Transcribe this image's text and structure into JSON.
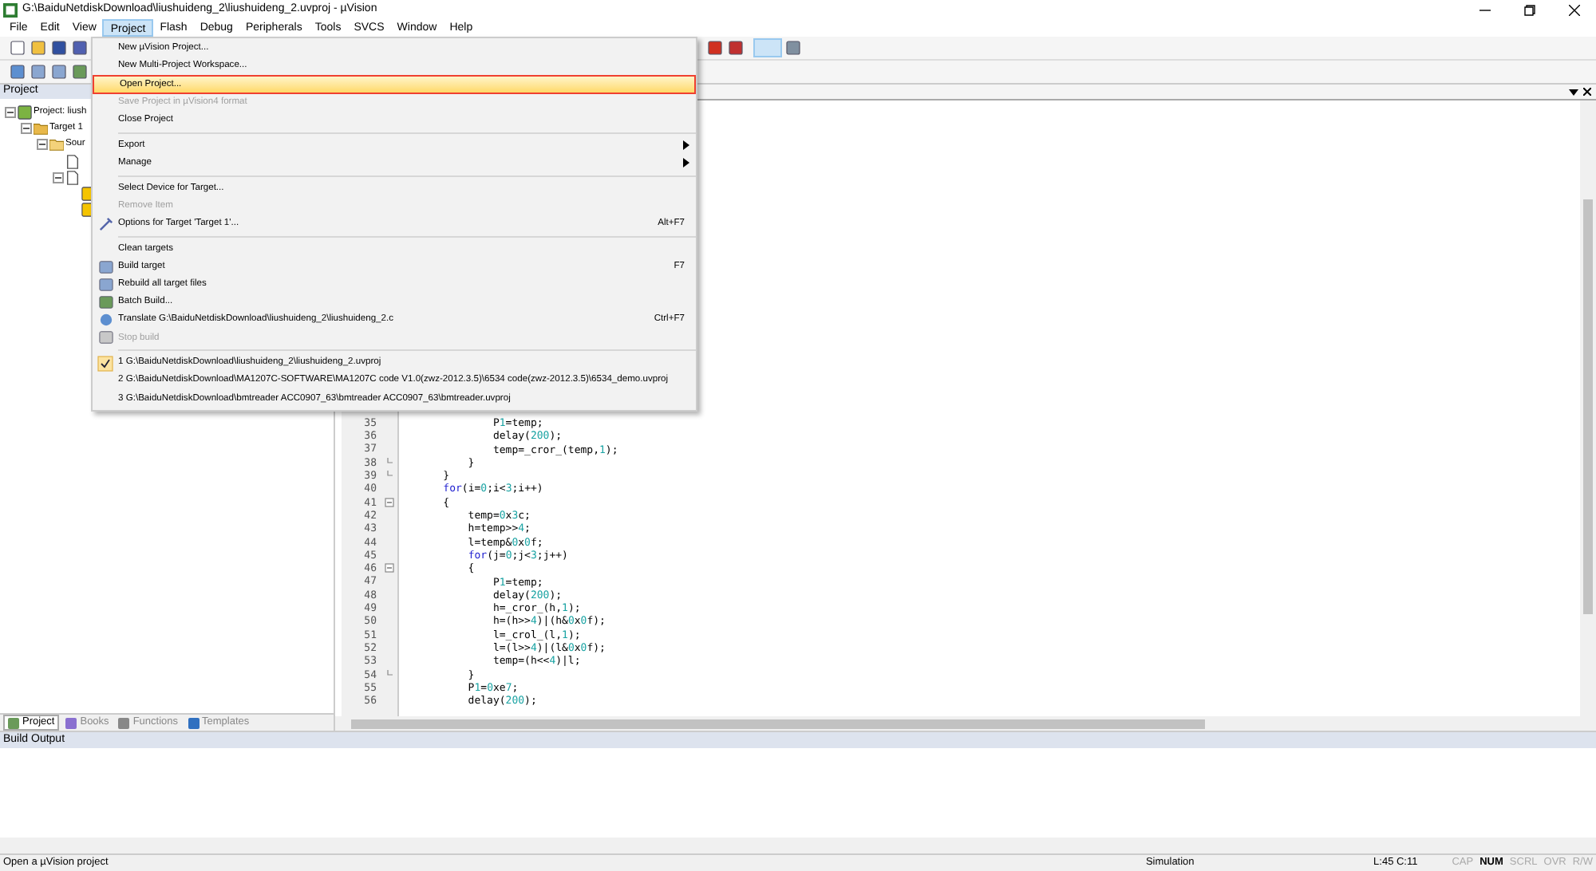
{
  "window": {
    "title": "G:\\BaiduNetdiskDownload\\liushuideng_2\\liushuideng_2.uvproj - µVision"
  },
  "menubar": [
    {
      "label": "File",
      "selected": false
    },
    {
      "label": "Edit",
      "selected": false
    },
    {
      "label": "View",
      "selected": false
    },
    {
      "label": "Project",
      "selected": true
    },
    {
      "label": "Flash",
      "selected": false
    },
    {
      "label": "Debug",
      "selected": false
    },
    {
      "label": "Peripherals",
      "selected": false
    },
    {
      "label": "Tools",
      "selected": false
    },
    {
      "label": "SVCS",
      "selected": false
    },
    {
      "label": "Window",
      "selected": false
    },
    {
      "label": "Help",
      "selected": false
    }
  ],
  "project_menu": [
    {
      "kind": "item",
      "label": "New µVision Project...",
      "disabled": false,
      "selected": false
    },
    {
      "kind": "item",
      "label": "New Multi-Project Workspace...",
      "disabled": false,
      "selected": false
    },
    {
      "kind": "item",
      "label": "Open Project...",
      "disabled": false,
      "selected": true
    },
    {
      "kind": "item",
      "label": "Save Project in µVision4 format",
      "disabled": true,
      "selected": false
    },
    {
      "kind": "item",
      "label": "Close Project",
      "disabled": false,
      "selected": false
    },
    {
      "kind": "separator"
    },
    {
      "kind": "item",
      "label": "Export",
      "disabled": false,
      "selected": false,
      "submenu": true
    },
    {
      "kind": "item",
      "label": "Manage",
      "disabled": false,
      "selected": false,
      "submenu": true
    },
    {
      "kind": "separator"
    },
    {
      "kind": "item",
      "label": "Select Device for Target...",
      "disabled": false,
      "selected": false
    },
    {
      "kind": "item",
      "label": "Remove Item",
      "disabled": true,
      "selected": false
    },
    {
      "kind": "item",
      "label": "Options for Target 'Target 1'...",
      "disabled": false,
      "selected": false,
      "shortcut": "Alt+F7"
    },
    {
      "kind": "separator"
    },
    {
      "kind": "item",
      "label": "Clean targets",
      "disabled": false,
      "selected": false
    },
    {
      "kind": "item",
      "label": "Build target",
      "disabled": false,
      "selected": false,
      "shortcut": "F7"
    },
    {
      "kind": "item",
      "label": "Rebuild all target files",
      "disabled": false,
      "selected": false
    },
    {
      "kind": "item",
      "label": "Batch Build...",
      "disabled": false,
      "selected": false
    },
    {
      "kind": "item",
      "label": "Translate G:\\BaiduNetdiskDownload\\liushuideng_2\\liushuideng_2.c",
      "disabled": false,
      "selected": false,
      "shortcut": "Ctrl+F7"
    },
    {
      "kind": "item",
      "label": "Stop build",
      "disabled": true,
      "selected": false
    },
    {
      "kind": "separator"
    },
    {
      "kind": "item",
      "label": "1 G:\\BaiduNetdiskDownload\\liushuideng_2\\liushuideng_2.uvproj",
      "disabled": false,
      "selected": false,
      "checked": true
    },
    {
      "kind": "item",
      "label": "2 G:\\BaiduNetdiskDownload\\MA1207C-SOFTWARE\\MA1207C code V1.0(zwz-2012.3.5)\\6534 code(zwz-2012.3.5)\\6534_demo.uvproj",
      "disabled": false,
      "selected": false,
      "checked": false
    },
    {
      "kind": "item",
      "label": "3 G:\\BaiduNetdiskDownload\\bmtreader ACC0907_63\\bmtreader ACC0907_63\\bmtreader.uvproj",
      "disabled": false,
      "selected": false,
      "checked": false
    }
  ],
  "project_panel": {
    "title": "Project",
    "tree": [
      {
        "label": "Project: liush",
        "kind": "project",
        "expanded": true,
        "children": [
          {
            "label": "Target 1",
            "kind": "target",
            "expanded": true,
            "children": [
              {
                "label": "Sour",
                "kind": "folder",
                "expanded": true,
                "children": [
                  {
                    "kind": "file"
                  },
                  {
                    "kind": "file",
                    "expanded": true,
                    "children": [
                      {
                        "kind": "header"
                      },
                      {
                        "kind": "header"
                      }
                    ]
                  }
                ]
              }
            ]
          }
        ]
      }
    ],
    "tabs": [
      {
        "label": "Project",
        "selected": true
      },
      {
        "label": "Books",
        "selected": false
      },
      {
        "label": "Functions",
        "selected": false
      },
      {
        "label": "Templates",
        "selected": false
      }
    ]
  },
  "editor": {
    "lines": [
      {
        "number": "35",
        "code": "            P1=temp;",
        "kind": "plain"
      },
      {
        "number": "36",
        "code": "            delay(200);",
        "kind": "plain"
      },
      {
        "number": "37",
        "code": "            temp=_cror_(temp,1);",
        "kind": "plain"
      },
      {
        "number": "38",
        "code": "        }",
        "kind": "fold_end"
      },
      {
        "number": "39",
        "code": "    }",
        "kind": "fold_end"
      },
      {
        "number": "40",
        "code": "    for(i=0;i<3;i++)",
        "kind": "plain"
      },
      {
        "number": "41",
        "code": "    {",
        "kind": "fold_open"
      },
      {
        "number": "42",
        "code": "        temp=0x3c;",
        "kind": "plain"
      },
      {
        "number": "43",
        "code": "        h=temp>>4;",
        "kind": "plain"
      },
      {
        "number": "44",
        "code": "        l=temp&0x0f;",
        "kind": "plain"
      },
      {
        "number": "45",
        "code": "        for(j=0;j<3;j++)",
        "kind": "plain"
      },
      {
        "number": "46",
        "code": "        {",
        "kind": "fold_open"
      },
      {
        "number": "47",
        "code": "            P1=temp;",
        "kind": "plain"
      },
      {
        "number": "48",
        "code": "            delay(200);",
        "kind": "plain"
      },
      {
        "number": "49",
        "code": "            h=_cror_(h,1);",
        "kind": "plain"
      },
      {
        "number": "50",
        "code": "            h=(h>>4)|(h&0x0f);",
        "kind": "plain"
      },
      {
        "number": "51",
        "code": "            l=_crol_(l,1);",
        "kind": "plain"
      },
      {
        "number": "52",
        "code": "            l=(l>>4)|(l&0x0f);",
        "kind": "plain"
      },
      {
        "number": "53",
        "code": "            temp=(h<<4)|l;",
        "kind": "plain"
      },
      {
        "number": "54",
        "code": "        }",
        "kind": "fold_end"
      },
      {
        "number": "55",
        "code": "        P1=0xe7;",
        "kind": "plain"
      },
      {
        "number": "56",
        "code": "        delay(200);",
        "kind": "plain"
      }
    ]
  },
  "build_output": {
    "title": "Build Output"
  },
  "status_bar": {
    "message": "Open a µVision project",
    "mode": "Simulation",
    "position": "L:45 C:11",
    "indicators": [
      {
        "label": "CAP",
        "on": false
      },
      {
        "label": "NUM",
        "on": true
      },
      {
        "label": "SCRL",
        "on": false
      },
      {
        "label": "OVR",
        "on": false
      },
      {
        "label": "R/W",
        "on": false
      }
    ]
  }
}
